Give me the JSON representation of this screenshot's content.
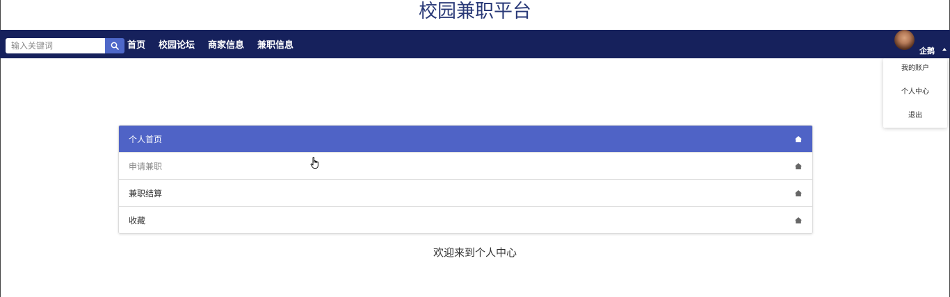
{
  "site": {
    "title": "校园兼职平台"
  },
  "navbar": {
    "search_placeholder": "输入关键词",
    "search_icon": "search-icon",
    "links": [
      "首页",
      "校园论坛",
      "商家信息",
      "兼职信息"
    ],
    "bg_color": "#16215c"
  },
  "user": {
    "name": "企鹅",
    "dropdown": [
      "我的账户",
      "个人中心",
      "退出"
    ]
  },
  "menu": {
    "items": [
      {
        "label": "个人首页",
        "icon": "home-icon",
        "active": true
      },
      {
        "label": "申请兼职",
        "icon": "home-icon",
        "active": false
      },
      {
        "label": "兼职结算",
        "icon": "home-icon",
        "active": false
      },
      {
        "label": "收藏",
        "icon": "home-icon",
        "active": false
      }
    ],
    "active_color": "#4f63c6"
  },
  "main": {
    "welcome": "欢迎来到个人中心"
  }
}
